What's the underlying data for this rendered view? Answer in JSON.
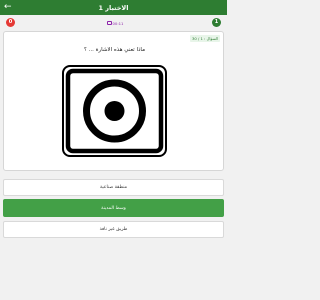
{
  "header": {
    "title": "الاختبار 1",
    "back_icon": "arrow-back-icon"
  },
  "score": {
    "wrong_count": "0",
    "right_count": "1"
  },
  "timer": {
    "text": "00:11"
  },
  "question_card": {
    "counter": "السؤال : 1 / 30",
    "question": "ماذا تعني هذه الاشارة ... ؟"
  },
  "answers": [
    {
      "label": "منطقة صناعية",
      "state": "default"
    },
    {
      "label": "وسط المدينة",
      "state": "correct"
    },
    {
      "label": "طريق غير نافذ",
      "state": "default"
    }
  ],
  "colors": {
    "primary": "#2e7d32",
    "correct": "#43a047",
    "wrong": "#e53935",
    "timer": "#8e24aa"
  }
}
